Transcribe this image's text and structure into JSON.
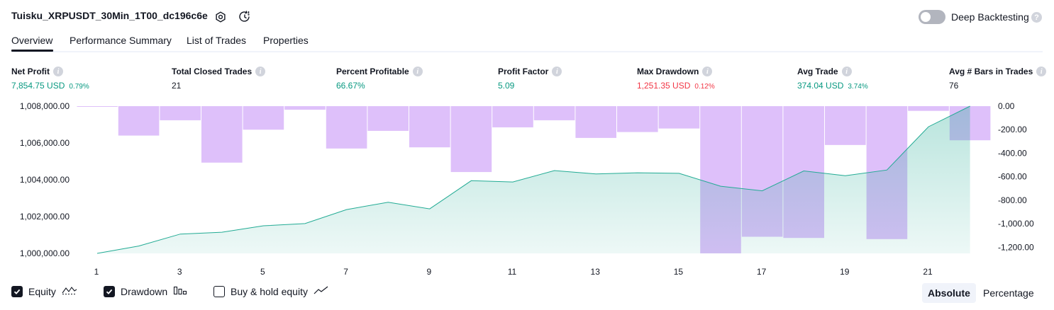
{
  "header": {
    "title": "Tuisku_XRPUSDT_30Min_1T00_dc196c6e",
    "deep_backtesting_label": "Deep Backtesting",
    "deep_backtesting_enabled": false,
    "help_glyph": "?"
  },
  "tabs": [
    {
      "label": "Overview",
      "active": true
    },
    {
      "label": "Performance Summary",
      "active": false
    },
    {
      "label": "List of Trades",
      "active": false
    },
    {
      "label": "Properties",
      "active": false
    }
  ],
  "metrics": [
    {
      "label": "Net Profit",
      "value": "7,854.75 USD",
      "pct": "0.79%",
      "color": "#089981"
    },
    {
      "label": "Total Closed Trades",
      "value": "21",
      "pct": "",
      "color": "#131722"
    },
    {
      "label": "Percent Profitable",
      "value": "66.67%",
      "pct": "",
      "color": "#089981"
    },
    {
      "label": "Profit Factor",
      "value": "5.09",
      "pct": "",
      "color": "#089981"
    },
    {
      "label": "Max Drawdown",
      "value": "1,251.35 USD",
      "pct": "0.12%",
      "color": "#f23645"
    },
    {
      "label": "Avg Trade",
      "value": "374.04 USD",
      "pct": "3.74%",
      "color": "#089981"
    },
    {
      "label": "Avg # Bars in Trades",
      "value": "76",
      "pct": "",
      "color": "#131722"
    }
  ],
  "chart_data": {
    "type": "area",
    "x": [
      1,
      2,
      3,
      4,
      5,
      6,
      7,
      8,
      9,
      10,
      11,
      12,
      13,
      14,
      15,
      16,
      17,
      18,
      19,
      20,
      21,
      22
    ],
    "x_tick_labels": [
      "1",
      "3",
      "5",
      "7",
      "9",
      "11",
      "13",
      "15",
      "17",
      "19",
      "21"
    ],
    "series": [
      {
        "name": "Equity",
        "axis": "left",
        "color": "#22ab94",
        "values": [
          1000000,
          1000400,
          1001050,
          1001150,
          1001500,
          1001620,
          1002380,
          1002780,
          1002420,
          1003950,
          1003880,
          1004500,
          1004320,
          1004380,
          1004350,
          1003650,
          1003400,
          1004480,
          1004220,
          1004530,
          1006880,
          1008000
        ]
      },
      {
        "name": "Drawdown",
        "axis": "right",
        "color": "#ce93d8",
        "values": [
          -5,
          -250,
          -120,
          -480,
          -200,
          -30,
          -360,
          -210,
          -350,
          -560,
          -180,
          -120,
          -270,
          -220,
          -190,
          -1251,
          -1110,
          -1120,
          -330,
          -1130,
          -40,
          -290
        ]
      }
    ],
    "left_axis": {
      "ticks": [
        "1,008,000.00",
        "1,006,000.00",
        "1,004,000.00",
        "1,002,000.00",
        "1,000,000.00"
      ],
      "min": 1000000,
      "max": 1008000
    },
    "right_axis": {
      "ticks": [
        "0.00",
        "-200.00",
        "-400.00",
        "-600.00",
        "-800.00",
        "-1,000.00",
        "-1,200.00"
      ],
      "min": -1251.35,
      "max": 0
    }
  },
  "legend": {
    "equity_label": "Equity",
    "equity_checked": true,
    "drawdown_label": "Drawdown",
    "drawdown_checked": true,
    "buyhold_label": "Buy & hold equity",
    "buyhold_checked": false
  },
  "view_mode": {
    "absolute_label": "Absolute",
    "percentage_label": "Percentage",
    "selected": "Absolute"
  }
}
